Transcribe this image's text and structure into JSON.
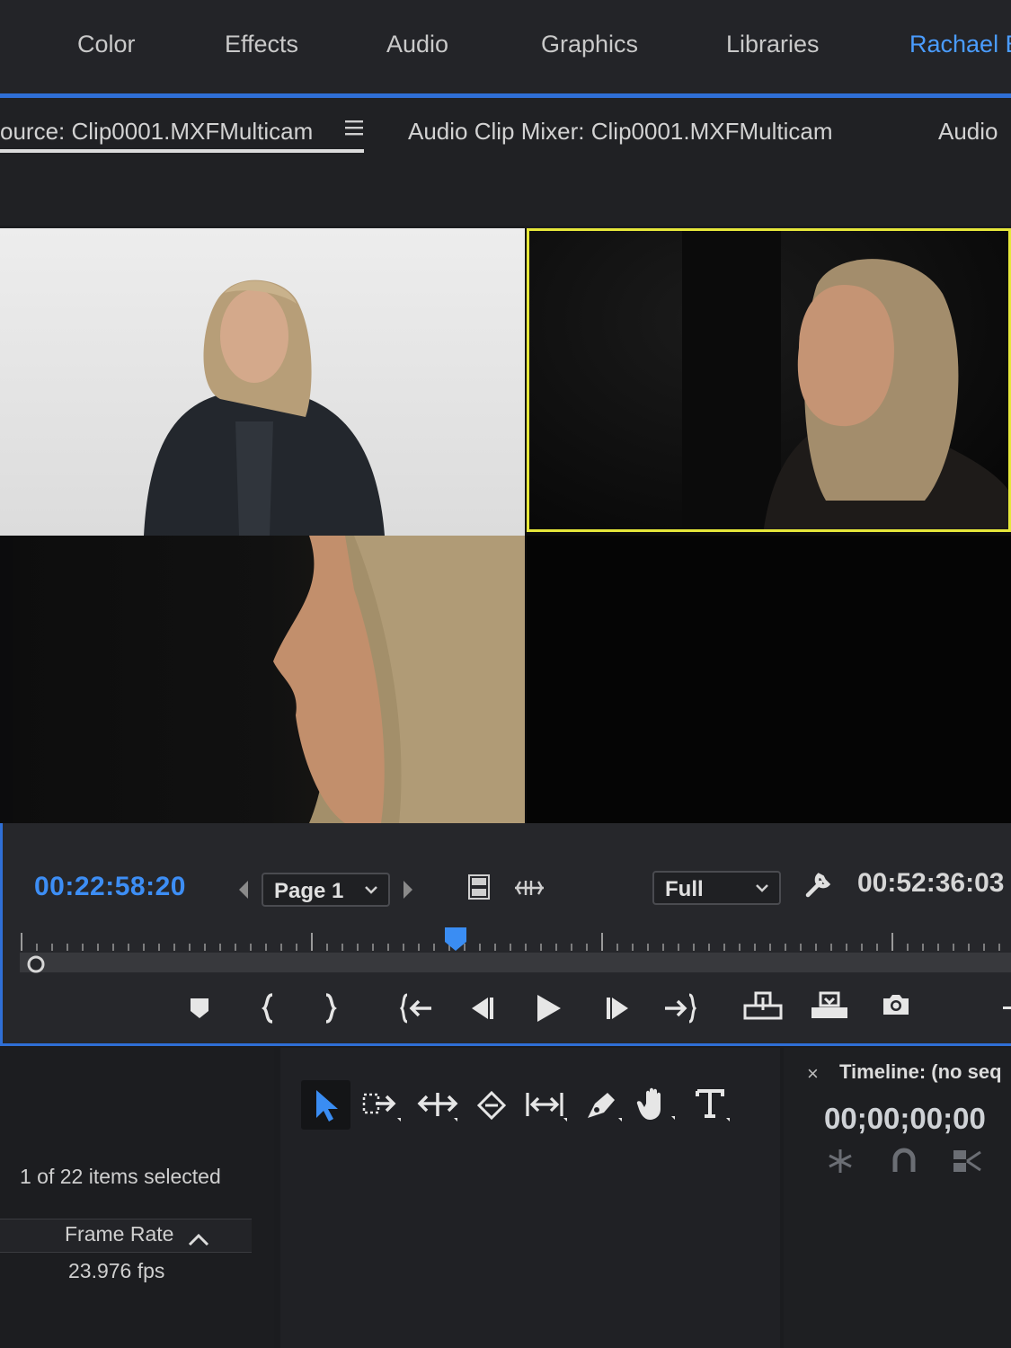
{
  "workspace": {
    "tabs": [
      {
        "label": "Color"
      },
      {
        "label": "Effects"
      },
      {
        "label": "Audio"
      },
      {
        "label": "Graphics"
      },
      {
        "label": "Libraries"
      },
      {
        "label": "Rachael E",
        "active": true
      }
    ],
    "accent_color": "#2f6fd6"
  },
  "panels": {
    "tabs": [
      {
        "label": "ource: Clip0001.MXFMulticam",
        "active": true
      },
      {
        "label": "Audio Clip Mixer: Clip0001.MXFMulticam"
      },
      {
        "label": "Audio"
      }
    ]
  },
  "multicam": {
    "active_angle_color": "#e6e73a",
    "active_angle": 2
  },
  "transport": {
    "current_timecode": "00:22:58:20",
    "duration_timecode": "00:52:36:03",
    "page_select": "Page 1",
    "zoom_select": "Full",
    "playhead_fraction": 0.44
  },
  "bottom": {
    "items_selected": "1 of 22 items selected",
    "column_header": "Frame Rate",
    "frame_rate_value": "23.976 fps",
    "timeline_title": "Timeline: (no seq",
    "timeline_close": "×",
    "timeline_timecode": "00;00;00;00"
  }
}
